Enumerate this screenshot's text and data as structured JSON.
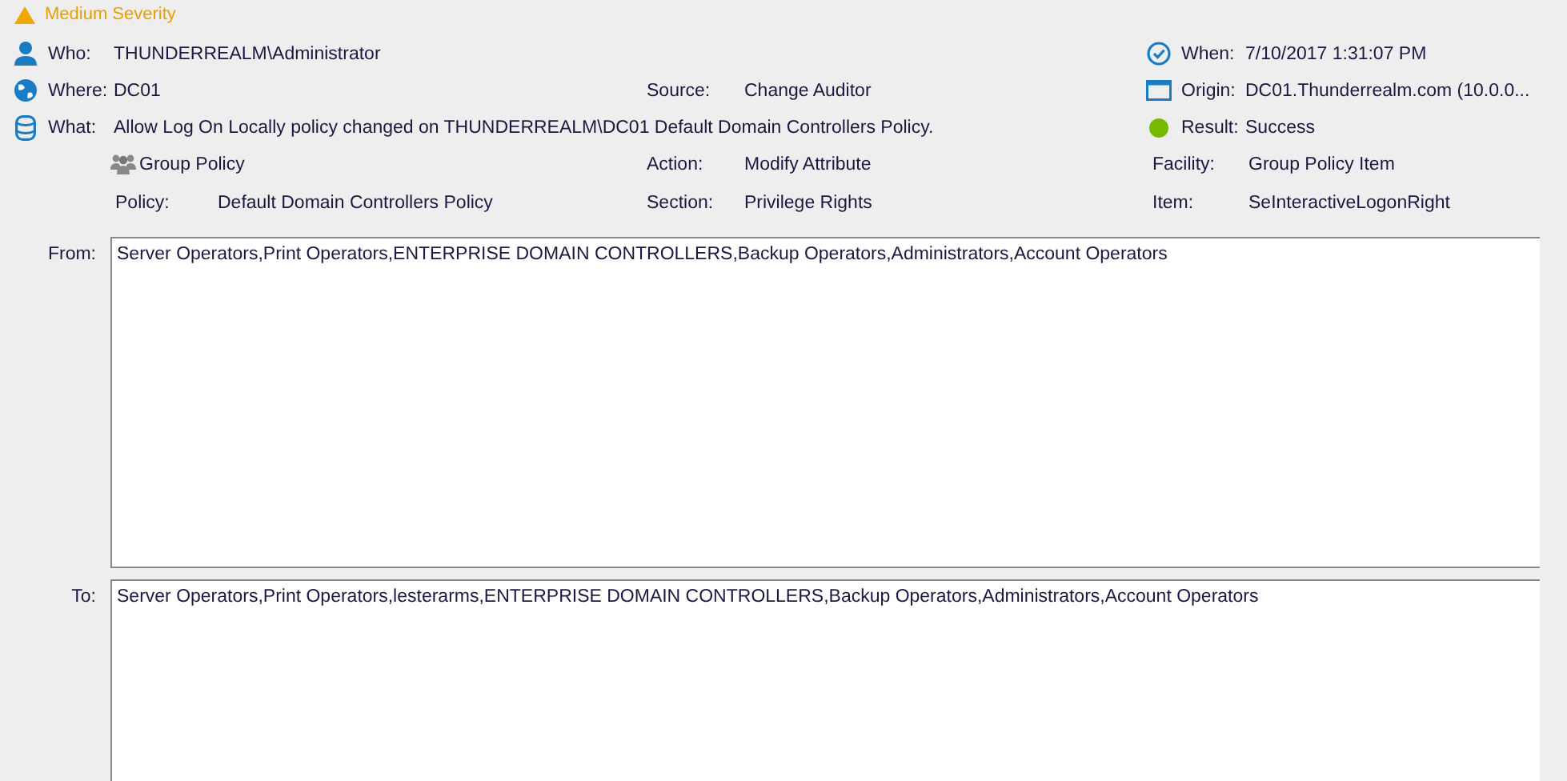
{
  "severity": {
    "text": "Medium Severity"
  },
  "who": {
    "label": "Who:",
    "value": "THUNDERREALM\\Administrator"
  },
  "when": {
    "label": "When:",
    "value": "7/10/2017 1:31:07 PM"
  },
  "where": {
    "label": "Where:",
    "value": "DC01"
  },
  "source": {
    "label": "Source:",
    "value": "Change Auditor"
  },
  "origin": {
    "label": "Origin:",
    "value": "DC01.Thunderrealm.com  (10.0.0..."
  },
  "what": {
    "label": "What:",
    "value": "Allow Log On Locally policy changed on THUNDERREALM\\DC01 Default Domain Controllers Policy."
  },
  "result": {
    "label": "Result:",
    "value": "Success"
  },
  "category": {
    "text": "Group Policy"
  },
  "action": {
    "label": "Action:",
    "value": "Modify Attribute"
  },
  "facility": {
    "label": "Facility:",
    "value": "Group Policy Item"
  },
  "policy": {
    "label": "Policy:",
    "value": "Default Domain Controllers Policy"
  },
  "section": {
    "label": "Section:",
    "value": "Privilege Rights"
  },
  "item": {
    "label": "Item:",
    "value": "SeInteractiveLogonRight"
  },
  "from": {
    "label": "From:",
    "value": "Server Operators,Print Operators,ENTERPRISE DOMAIN CONTROLLERS,Backup Operators,Administrators,Account Operators"
  },
  "to": {
    "label": "To:",
    "value": "Server Operators,Print Operators,lesterarms,ENTERPRISE DOMAIN CONTROLLERS,Backup Operators,Administrators,Account Operators"
  }
}
